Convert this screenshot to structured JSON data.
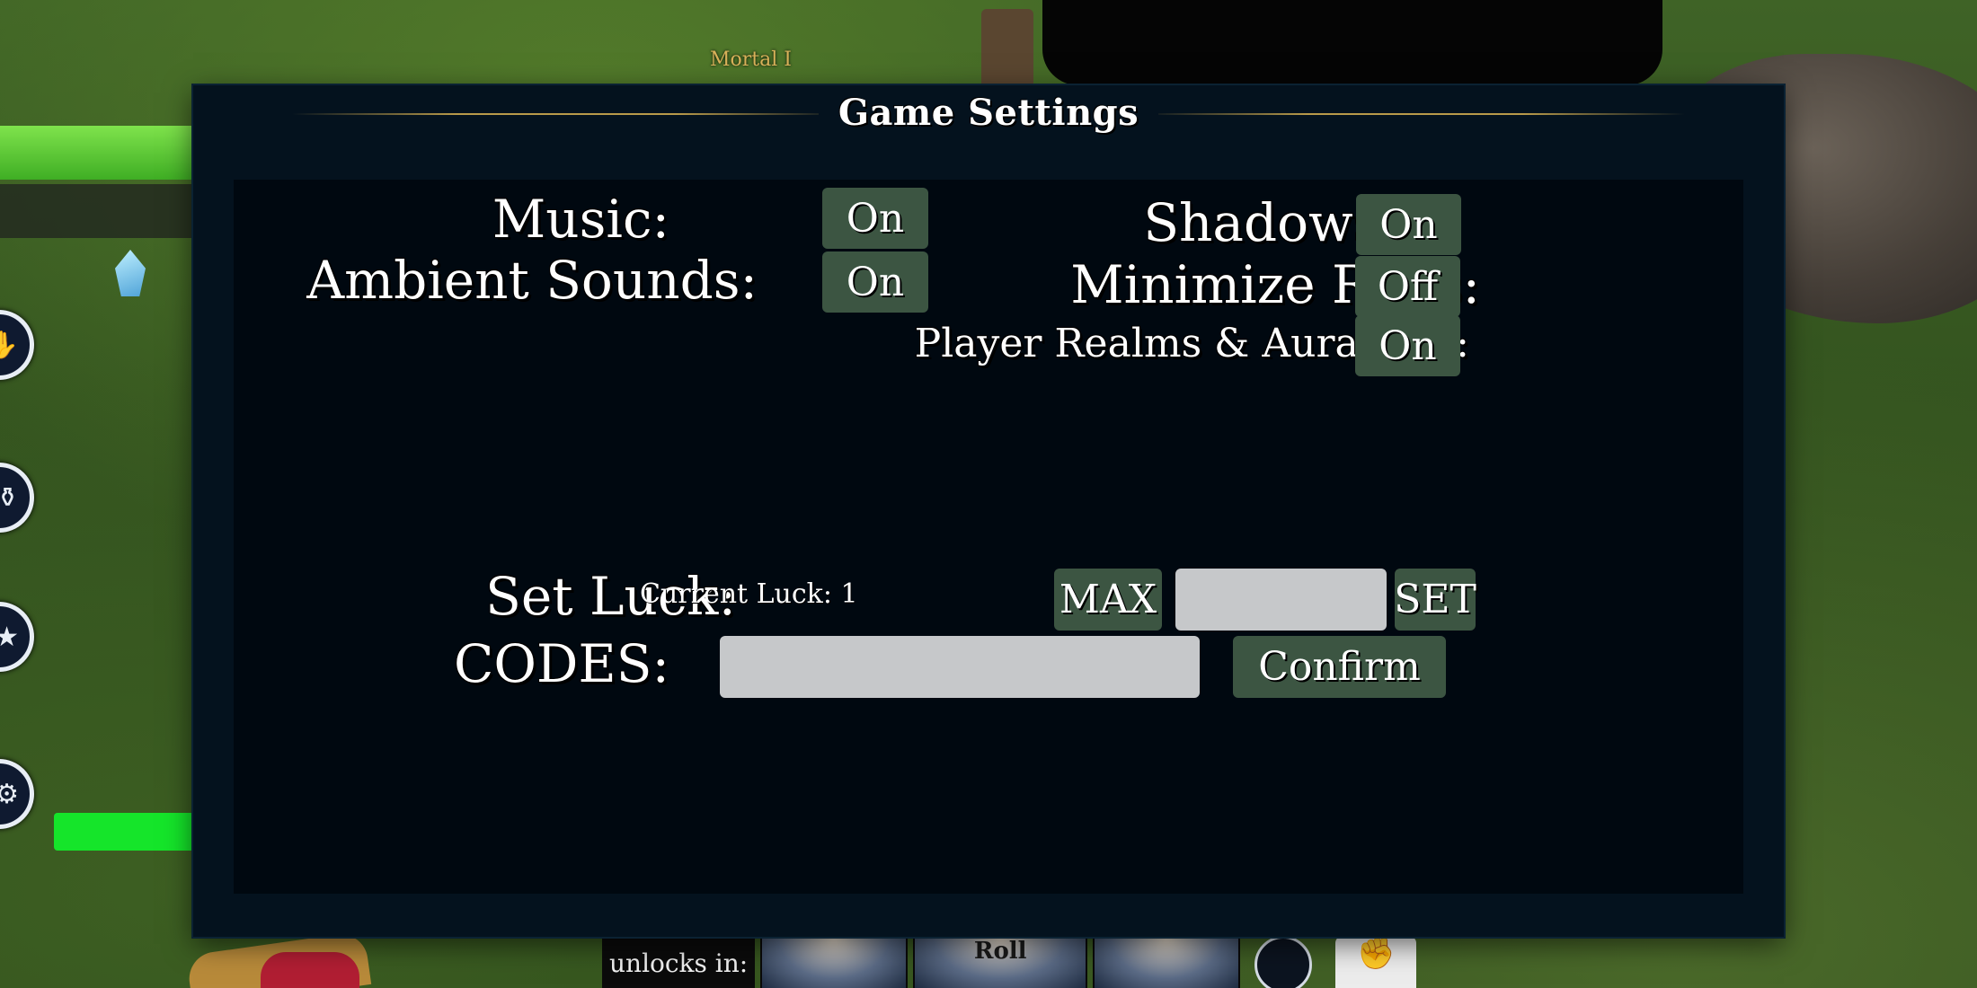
{
  "world": {
    "nametag": "Mortal I",
    "unlocks_label": "unlocks in:",
    "roll_tile": "Roll",
    "side_icons": [
      "hand-icon",
      "potion-icon",
      "star-icon",
      "gear-icon"
    ]
  },
  "settings": {
    "title": "Game Settings",
    "music": {
      "label": "Music:",
      "value": "On"
    },
    "ambient": {
      "label": "Ambient Sounds:",
      "value": "On"
    },
    "shadows": {
      "label": "Shadows:",
      "value": "On"
    },
    "minimize_rolls": {
      "label": "Minimize Rolls:",
      "value": "Off"
    },
    "realms_text": {
      "label": "Player Realms & Aura Text:",
      "value": "On"
    },
    "luck": {
      "label": "Set Luck:",
      "current": "Current Luck: 1",
      "max_label": "MAX",
      "input_value": "",
      "set_label": "SET"
    },
    "codes": {
      "label": "CODES:",
      "input_value": "",
      "confirm_label": "Confirm"
    }
  },
  "colors": {
    "panel": "#04121e",
    "inner": "#000810",
    "button": "#3c5542",
    "field": "#c6c8ca",
    "title_rule": "#b99a4a"
  }
}
